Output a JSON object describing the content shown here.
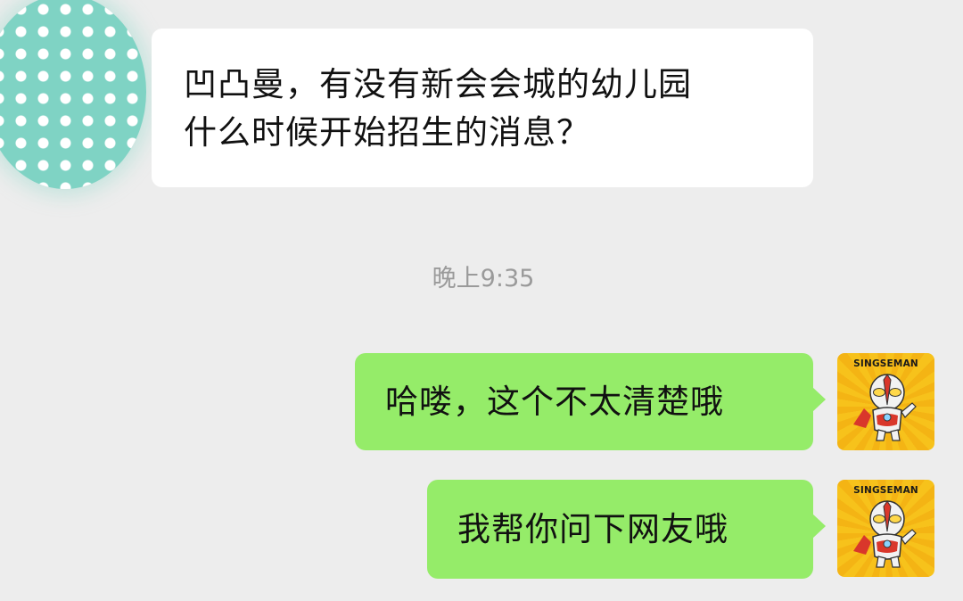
{
  "incoming": {
    "avatar_icon": "polka-dot-avatar",
    "message_lines": [
      "凹凸曼，有没有新会会城的幼儿园",
      "什么时候开始招生的消息？"
    ]
  },
  "timestamp": "晚上9:35",
  "outgoing": [
    {
      "text": "哈喽，这个不太清楚哦",
      "avatar_brand": "SINGSEMAN"
    },
    {
      "text": "我帮你问下网友哦",
      "avatar_brand": "SINGSEMAN"
    }
  ],
  "colors": {
    "background": "#ededed",
    "incoming_bubble": "#ffffff",
    "outgoing_bubble": "#95ec69",
    "timestamp": "#9a9a9a",
    "avatar_dots_bg": "#7fd3c4",
    "avatar_hero_bg": "#f7c21b"
  }
}
